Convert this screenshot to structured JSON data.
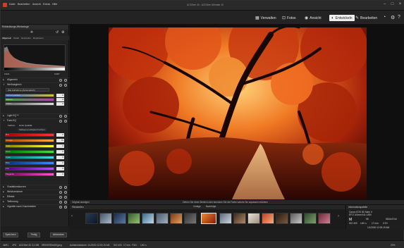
{
  "app": {
    "title": "ACDSee 40 - ACDSee Ultimate 10",
    "menu": [
      "Datei",
      "Bearbeiten",
      "Ansicht",
      "Extras",
      "Hilfe"
    ]
  },
  "modes": {
    "manage": "Verwalten",
    "photos": "Fotos",
    "view": "Ansicht",
    "develop": "Entwickeln",
    "edit": "Bearbeiten"
  },
  "left_panel": {
    "header": "Entwicklungs-Werkzeuge",
    "tabs": [
      "Allgemein",
      "Detail",
      "Geometrie",
      "Reparieren"
    ],
    "histogram_left": "0.921",
    "histogram_right": "0.087",
    "sections": {
      "allgemein": "Allgemein",
      "weissabgleich": "Weißabgleich",
      "wb_select": "Wie Aufnahme (Automatisch)",
      "lightEQ": "Light EQ™",
      "farbEQ": "Farb-EQ",
      "farbEQ_tab1": "Farbton",
      "farbEQ_tab2": "Hohe Qualität",
      "farbEQ_sub": "Sättigung  Helligkeit  Farbton",
      "gradation": "Gradationskurven",
      "weichzeichner": "Weichzeichner",
      "effekte": "Effekte",
      "teiltonung": "Teiltonung",
      "vignette": "Vignette nach Zuschneiden"
    },
    "wb_sliders": [
      {
        "label": "Farbtemperatur",
        "value": "0"
      },
      {
        "label": "Farbton",
        "value": "0"
      },
      {
        "label": "Stärke",
        "value": "0"
      }
    ],
    "farb_sliders": [
      {
        "label": "Rot",
        "value": "0"
      },
      {
        "label": "Orange",
        "value": "70"
      },
      {
        "label": "Gelb",
        "value": "0"
      },
      {
        "label": "Grün",
        "value": "0"
      },
      {
        "label": "Cyan",
        "value": "0"
      },
      {
        "label": "Blau",
        "value": "0"
      },
      {
        "label": "Lila",
        "value": "0"
      },
      {
        "label": "Magenta",
        "value": "0"
      }
    ],
    "buttons": {
      "save": "Speichern",
      "done": "Fertig",
      "cancel": "Abbrechen"
    }
  },
  "info_strip": {
    "left": "Original anzeigen",
    "center": "Ziehen Sie einen Bereich oder benutzen Sie die Farbe welche Sie anpassen möchten"
  },
  "filmstrip": {
    "header": "Filmstreifen",
    "tabs": [
      "Vorlage",
      "Nachträge"
    ]
  },
  "info_panel": {
    "header": "Informationspalette",
    "camera": "Canon EOS 5D Mark II",
    "lens": "EF17-40mm f/4L USM",
    "mode": "M",
    "iso": "ISO 400",
    "aperture": "f/8",
    "shutter": "1/40 s",
    "focal": "17 mm",
    "ev": "0 EV",
    "size": "5616x3744",
    "date": "1/1/2000 12:00:19 AM"
  },
  "status_bar": {
    "index": "46/91",
    "format": "JPG",
    "app": "ACDSee 40",
    "filesize": "3,1 MB",
    "filename": "5R5X5789rA06.jpeg",
    "taken": "Aufnahmedatum: 1/1/2000 12:00:19 AM",
    "iso": "ISO 400",
    "focal": "17 mm",
    "aperture": "F/8.0",
    "shutter": "1/40 s",
    "zoom": "20%"
  },
  "colors": {
    "accent": "#efefef",
    "panel": "#222222",
    "photo_main": "#c0380d"
  },
  "icons": [
    "manage-icon",
    "photos-icon",
    "view-icon",
    "develop-icon",
    "edit-icon",
    "gear-icon",
    "help-icon"
  ]
}
